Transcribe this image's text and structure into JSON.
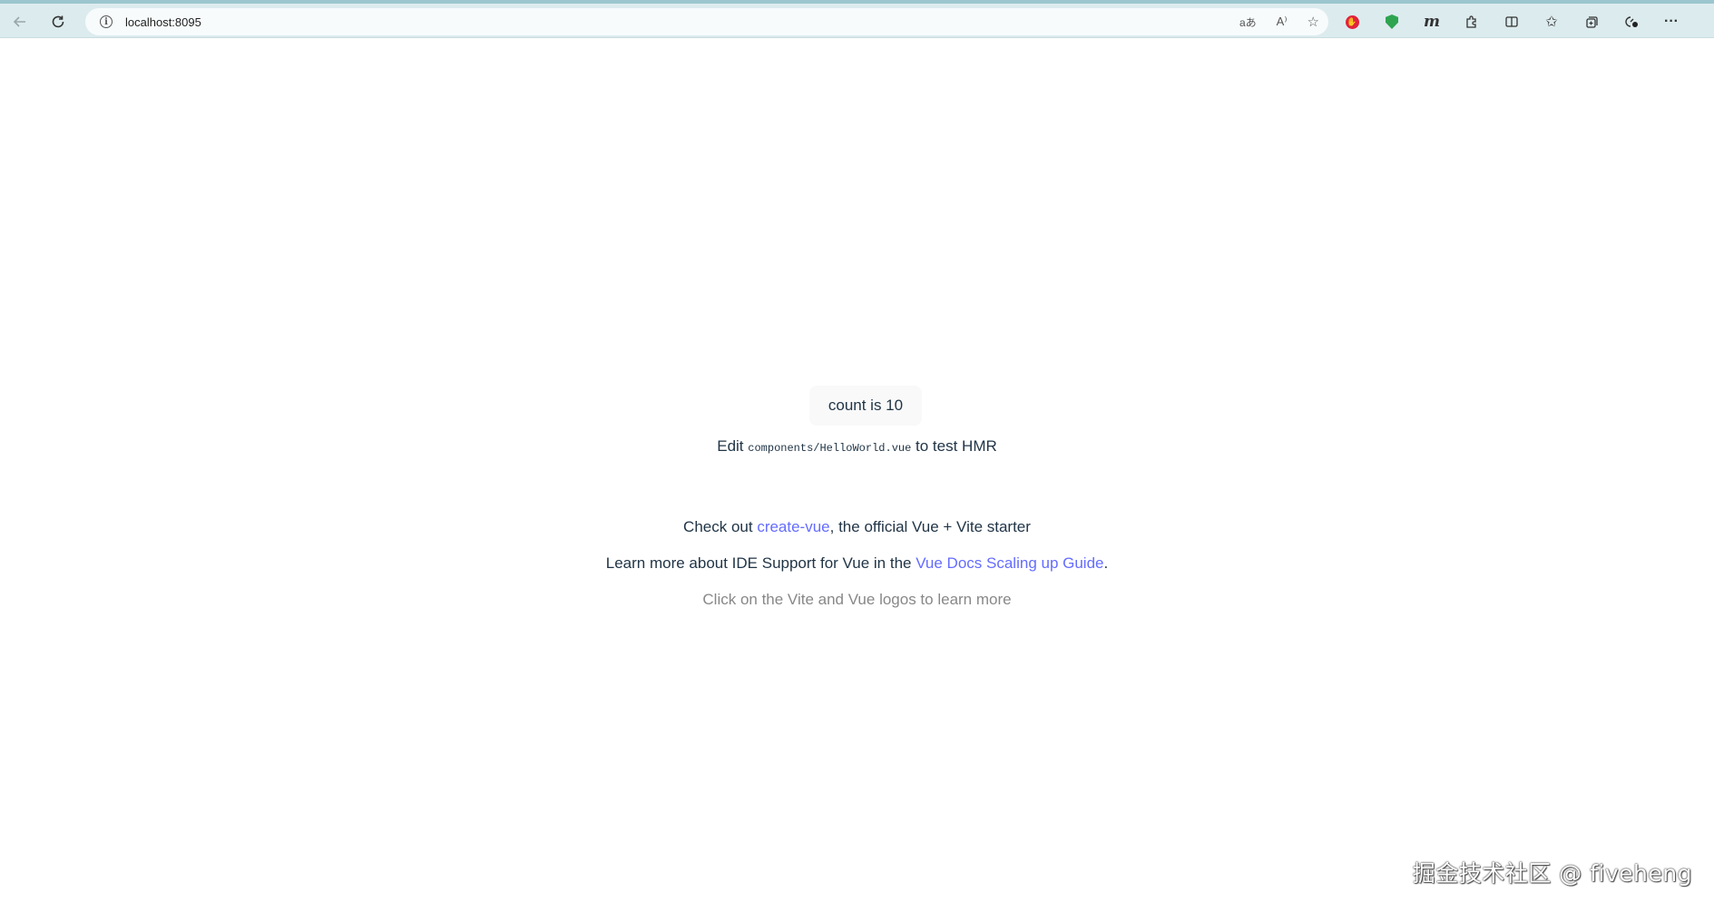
{
  "browser": {
    "url": "localhost:8095",
    "icons": {
      "back": "back-arrow-icon",
      "refresh": "refresh-icon",
      "info": "info-icon",
      "translate": "translate-icon",
      "read_aloud": "read-aloud-icon",
      "favorite": "star-icon"
    },
    "translate_glyph": "aあ",
    "read_aloud_glyph": "A⁾",
    "extensions": [
      "adblock-shield-icon",
      "green-shield-icon",
      "m-extension-icon",
      "puzzle-extensions-icon",
      "split-screen-icon",
      "favorites-icon",
      "collections-icon",
      "performance-icon",
      "more-menu-icon"
    ]
  },
  "main": {
    "count_button_label": "count is 10",
    "edit_prefix": "Edit ",
    "edit_code": "components/HelloWorld.vue",
    "edit_suffix": " to test HMR",
    "checkout_prefix": "Check out ",
    "checkout_link": "create-vue",
    "checkout_suffix": ", the official Vue + Vite starter",
    "learn_prefix": "Learn more about IDE Support for Vue in the ",
    "learn_link": "Vue Docs Scaling up Guide",
    "learn_suffix": ".",
    "read_the_docs": "Click on the Vite and Vue logos to learn more"
  },
  "watermark": "掘金技术社区 @ fiveheng",
  "colors": {
    "text": "#213547",
    "link": "#646cff",
    "muted": "#888888",
    "button_bg": "#f9f9f9"
  }
}
